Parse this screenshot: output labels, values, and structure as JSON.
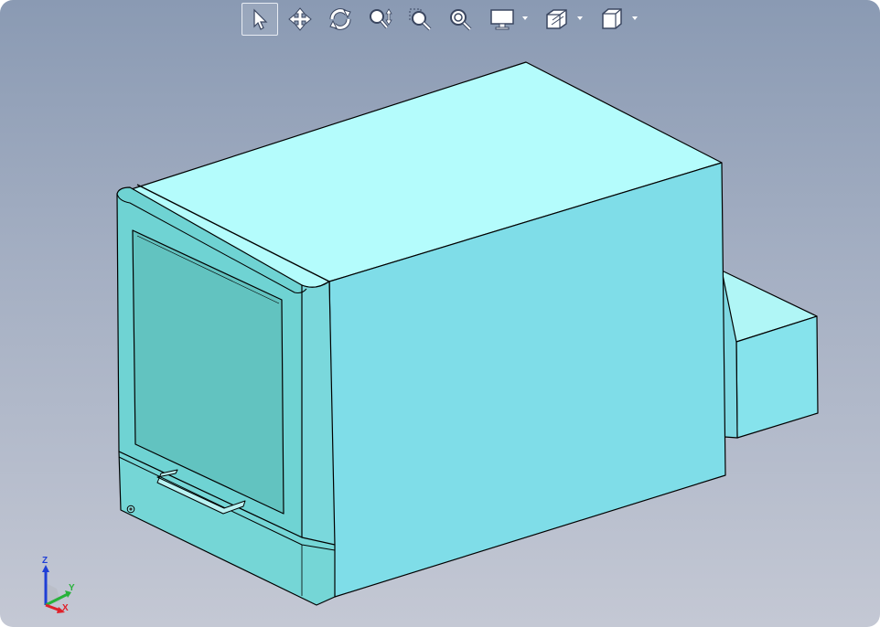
{
  "toolbar": {
    "buttons": [
      {
        "id": "select",
        "icon": "pointer-icon",
        "active": true
      },
      {
        "id": "pan",
        "icon": "move-arrows-icon",
        "active": false
      },
      {
        "id": "rotate",
        "icon": "rotate-icon",
        "active": false
      },
      {
        "id": "zoom-dynamic",
        "icon": "zoom-updown-icon",
        "active": false
      },
      {
        "id": "zoom-box",
        "icon": "zoom-box-icon",
        "active": false
      },
      {
        "id": "zoom-fit",
        "icon": "zoom-fit-icon",
        "active": false
      },
      {
        "id": "display-style",
        "icon": "monitor-icon",
        "dropdown": true
      },
      {
        "id": "section-view",
        "icon": "section-view-icon",
        "dropdown": true
      },
      {
        "id": "view-orientation",
        "icon": "cube-icon",
        "dropdown": true
      }
    ]
  },
  "triad": {
    "z_label": "Z",
    "y_label": "Y",
    "x_label": "X"
  },
  "colors": {
    "model_top": "#b4fcfc",
    "model_side": "#7fdde8",
    "model_front": "#6ccfcf",
    "window": "#62c3c0",
    "edge": "#000000",
    "axis_x": "#e0202a",
    "axis_y": "#27b23a",
    "axis_z": "#1f3fd6"
  }
}
